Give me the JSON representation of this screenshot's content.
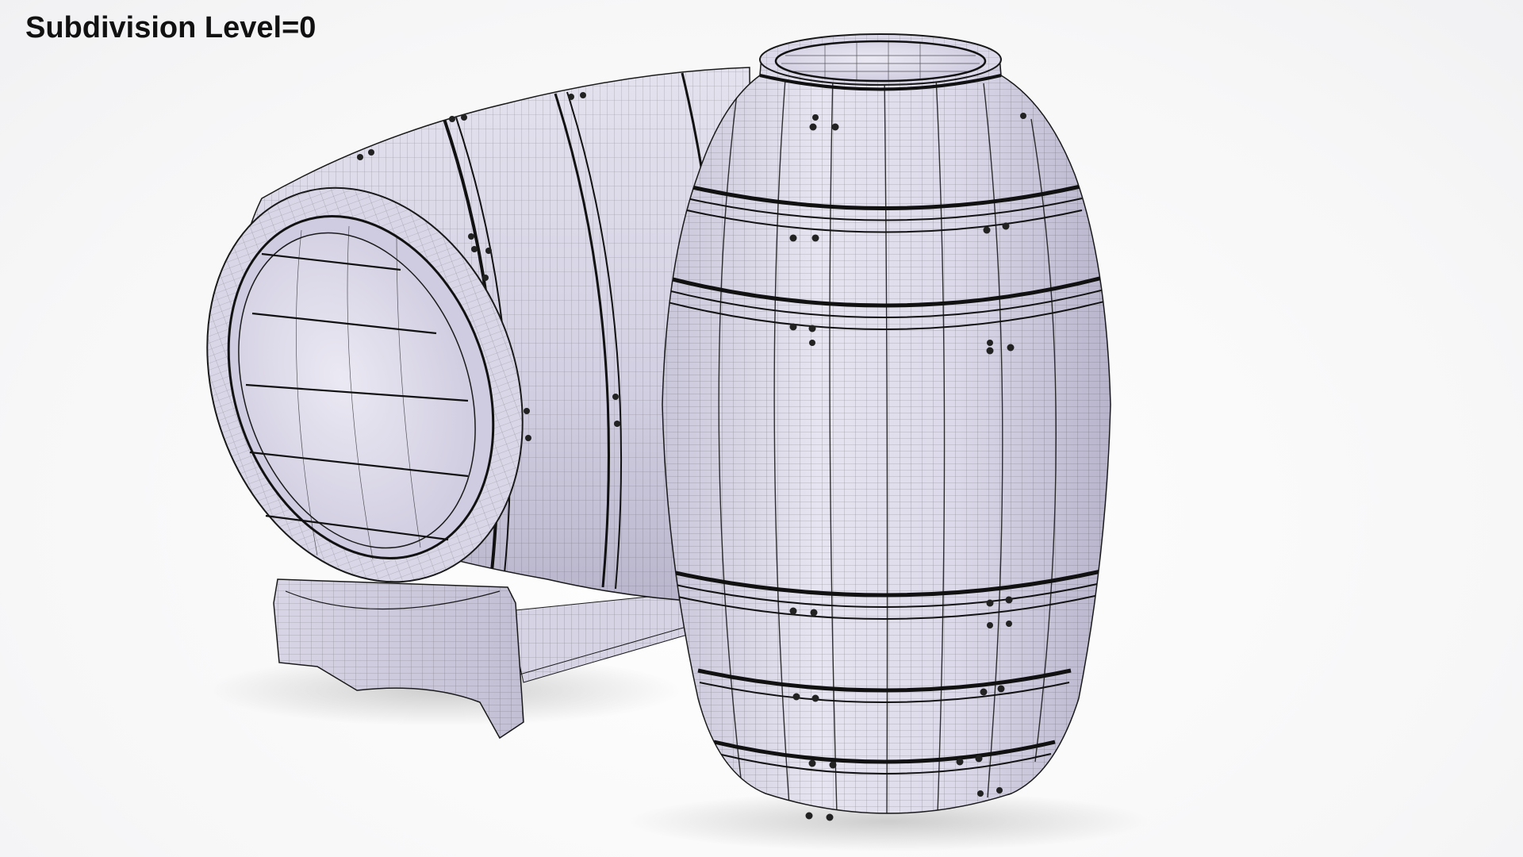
{
  "caption": {
    "text": "Subdivision Level=0"
  },
  "scene": {
    "objects": [
      "lying-barrel-on-stand",
      "upright-barrel"
    ],
    "render_style": "wireframe-on-shaded",
    "colors": {
      "background": "#f5f5f7",
      "surface": "#dcd9ea",
      "surface_shade": "#bdb9d0",
      "wire": "#1a1a1a",
      "band": "#111111"
    }
  }
}
